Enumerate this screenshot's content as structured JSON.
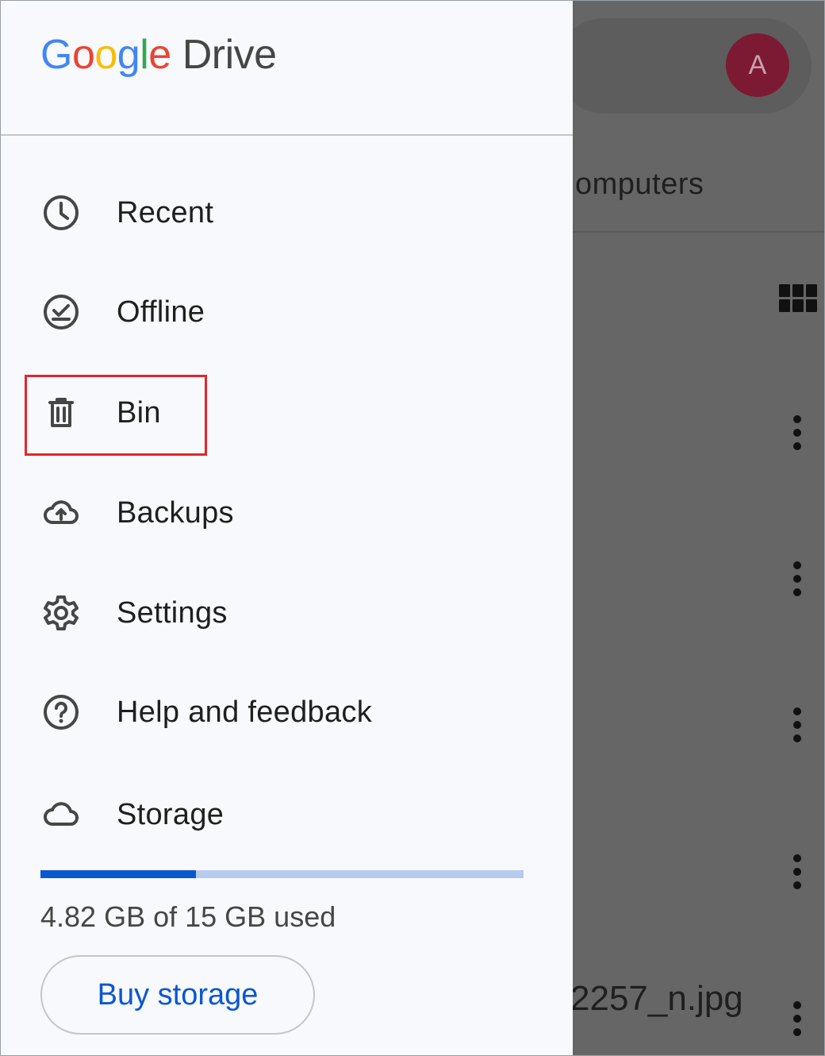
{
  "app": {
    "logo_parts": [
      "G",
      "o",
      "o",
      "g",
      "l",
      "e"
    ],
    "product": "Drive"
  },
  "background": {
    "avatar_initial": "A",
    "tab_label": "omputers",
    "file_name": "2257_n.jpg"
  },
  "nav": {
    "items": [
      {
        "label": "Recent",
        "icon": "clock-icon"
      },
      {
        "label": "Offline",
        "icon": "offline-check-icon"
      },
      {
        "label": "Bin",
        "icon": "trash-icon"
      },
      {
        "label": "Backups",
        "icon": "cloud-upload-icon"
      },
      {
        "label": "Settings",
        "icon": "gear-icon"
      },
      {
        "label": "Help and feedback",
        "icon": "help-icon"
      },
      {
        "label": "Storage",
        "icon": "cloud-icon"
      }
    ],
    "highlighted_item": "Bin"
  },
  "storage": {
    "used_text": "4.82 GB of 15 GB used",
    "used_gb": 4.82,
    "total_gb": 15,
    "buy_label": "Buy storage"
  },
  "colors": {
    "accent": "#0b57d0",
    "bar_track": "#b7cbee",
    "highlight": "#e1262c",
    "avatar": "#7c1a33"
  }
}
